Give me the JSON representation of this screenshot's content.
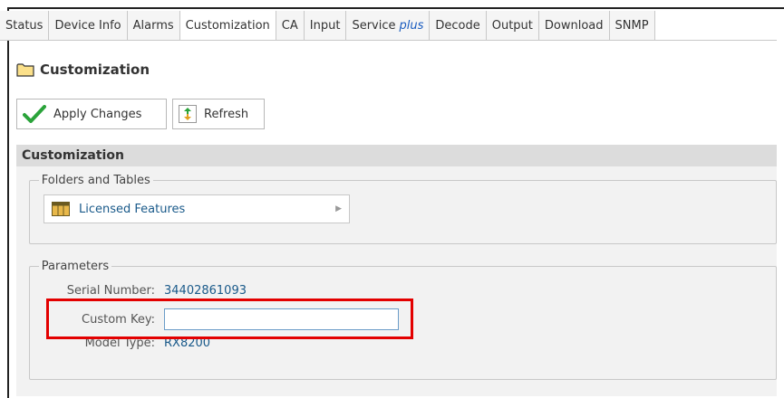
{
  "tabs": [
    {
      "label": "Status"
    },
    {
      "label": "Device Info"
    },
    {
      "label": "Alarms"
    },
    {
      "label": "Customization",
      "active": true
    },
    {
      "label": "CA"
    },
    {
      "label": "Input"
    },
    {
      "label": "Service",
      "suffix": "plus"
    },
    {
      "label": "Decode"
    },
    {
      "label": "Output"
    },
    {
      "label": "Download"
    },
    {
      "label": "SNMP"
    }
  ],
  "page": {
    "title": "Customization",
    "title_icon": "folder-icon"
  },
  "toolbar": {
    "apply_label": "Apply Changes",
    "apply_icon": "checkmark-icon",
    "refresh_label": "Refresh",
    "refresh_icon": "refresh-icon"
  },
  "section": {
    "title": "Customization"
  },
  "folders": {
    "legend": "Folders and Tables",
    "items": [
      {
        "label": "Licensed Features",
        "icon": "table-icon"
      }
    ]
  },
  "parameters": {
    "legend": "Parameters",
    "serial_label": "Serial Number:",
    "serial_value": "34402861093",
    "custom_key_label": "Custom Key:",
    "custom_key_value": "",
    "model_label": "Model Type:",
    "model_value": "RX8200"
  },
  "colors": {
    "link": "#1a5a8a",
    "highlight": "#e30000",
    "section_band": "#dcdcdc"
  }
}
